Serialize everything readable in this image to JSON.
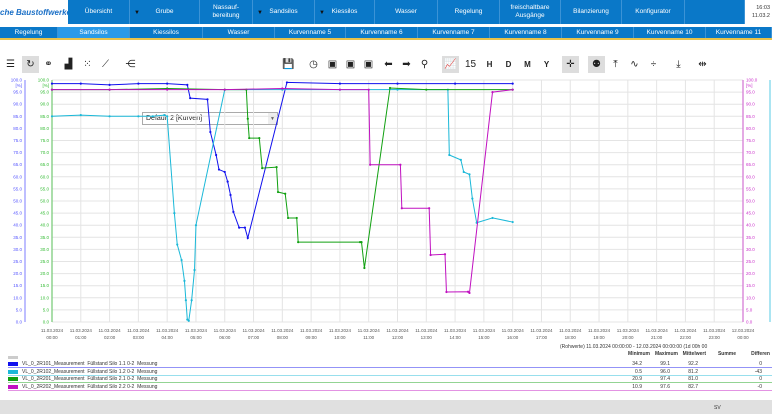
{
  "header": {
    "logo": "che Baustoffwerke",
    "time": "16:03",
    "date": "11.03.2",
    "nav": [
      {
        "label": "Übersicht",
        "chev": false
      },
      {
        "label": "Grube",
        "chev": true
      },
      {
        "label": "Nassauf-\nbereitung",
        "chev": false
      },
      {
        "label": "Sandsilos",
        "chev": true
      },
      {
        "label": "Kiessilos",
        "chev": true
      },
      {
        "label": "Wasser",
        "chev": false
      },
      {
        "label": "Regelung",
        "chev": false
      },
      {
        "label": "freischaltbare\nAusgänge",
        "chev": false
      },
      {
        "label": "Bilanzierung",
        "chev": false
      },
      {
        "label": "Konfigurator",
        "chev": false
      }
    ]
  },
  "subnav": {
    "active": 1,
    "items": [
      "Regelung",
      "Sandsilos",
      "Kiessilos",
      "Wasser",
      "Kurvenname 5",
      "Kurvenname 6",
      "Kurvenname 7",
      "Kurvenname 8",
      "Kurvenname 9",
      "Kurvenname 10",
      "Kurvenname 11"
    ]
  },
  "toolbar": {
    "preset": "Default 2 [Kurven]"
  },
  "chart_data": {
    "type": "line",
    "unit": "[%]",
    "ylim": [
      0,
      100
    ],
    "yticks": [
      0,
      5,
      10,
      15,
      20,
      25,
      30,
      35,
      40,
      45,
      50,
      55,
      60,
      65,
      70,
      75,
      80,
      85,
      90,
      95,
      100
    ],
    "xlim": [
      0,
      24
    ],
    "xdate": "11.03.2024",
    "xdate_end": "12.03.2024",
    "xticks": [
      "00:00",
      "01:00",
      "02:00",
      "03:00",
      "04:00",
      "05:00",
      "06:00",
      "07:00",
      "08:00",
      "09:00",
      "10:00",
      "11:00",
      "12:00",
      "13:00",
      "14:00",
      "15:00",
      "16:00",
      "17:00",
      "18:00",
      "19:00",
      "20:00",
      "21:00",
      "22:00",
      "23:00",
      "00:00"
    ],
    "series": [
      {
        "name": "VL_0_2R101_Measurement",
        "desc": "Füllstand Silo 1.1 0-2",
        "type": "Messung",
        "color": "#1010ee",
        "x": [
          0,
          1,
          2,
          3,
          4,
          4.7,
          4.8,
          5.4,
          5.5,
          5.7,
          5.8,
          6.0,
          6.1,
          6.2,
          6.3,
          6.5,
          6.7,
          6.8,
          8.16,
          10,
          12,
          14,
          16
        ],
        "y": [
          98.5,
          98.5,
          98,
          98.5,
          98.5,
          98,
          92.5,
          92,
          78.5,
          69,
          63,
          62,
          58,
          52.5,
          45.5,
          39,
          39,
          34.7,
          99,
          98.5,
          98.5,
          98.5,
          98.5
        ],
        "min": "34.2",
        "max": "99.1",
        "avg": "92.2",
        "sum": "",
        "diff": "0"
      },
      {
        "name": "VL_0_2R102_Measurement",
        "desc": "Füllstand Silo 1.2 0-2",
        "type": "Messung",
        "color": "#1ab8d8",
        "x": [
          0,
          1,
          2,
          3,
          3.5,
          3.9,
          4.0,
          4.25,
          4.35,
          4.5,
          4.6,
          4.65,
          4.7,
          4.75,
          4.85,
          4.95,
          5.0,
          6.0,
          8,
          10,
          12,
          13.75,
          13.8,
          14.2,
          14.3,
          14.5,
          14.6,
          14.75,
          15.3,
          16
        ],
        "y": [
          85,
          85.5,
          85,
          85,
          85,
          85.5,
          85,
          45,
          32,
          25.6,
          17,
          9,
          1,
          0.5,
          9,
          21.5,
          40,
          96,
          96,
          96,
          96,
          96,
          69,
          67,
          62,
          61,
          51,
          41,
          43,
          41.3
        ],
        "min": "0.5",
        "max": "96.0",
        "avg": "81.2",
        "sum": "",
        "diff": "-43"
      },
      {
        "name": "VL_0_2R201_Measurement",
        "desc": "Füllstand Silo 2.1 0-2",
        "type": "Messung",
        "color": "#10a010",
        "x": [
          0,
          2,
          4,
          6,
          6.75,
          6.8,
          6.85,
          7.2,
          7.3,
          7.8,
          7.85,
          8.1,
          8.2,
          8.5,
          8.55,
          10.7,
          10.75,
          10.85,
          11.74,
          13,
          16
        ],
        "y": [
          96,
          96,
          96.5,
          96,
          96,
          84,
          76,
          76,
          63.6,
          64,
          53.7,
          53,
          43,
          43,
          33,
          33,
          33,
          22.3,
          96.7,
          96,
          96
        ],
        "min": "20.9",
        "max": "97.4",
        "avg": "81.0",
        "sum": "",
        "diff": "0"
      },
      {
        "name": "VL_0_2R202_Measurement",
        "desc": "Füllstand Silo 2.2 0-2",
        "type": "Messung",
        "color": "#c010c0",
        "x": [
          0,
          2,
          4,
          6,
          8,
          10,
          11.0,
          11.05,
          12.1,
          12.15,
          13.1,
          13.15,
          13.65,
          13.7,
          14.45,
          14.5,
          15.3,
          16
        ],
        "y": [
          96,
          96,
          96,
          96,
          96.5,
          96,
          96,
          65,
          65,
          47,
          47,
          27.7,
          28,
          12.4,
          12.5,
          12,
          95,
          96
        ],
        "min": "10.9",
        "max": "97.6",
        "avg": "82.7",
        "sum": "",
        "diff": "-0"
      }
    ],
    "range_label": "(Rohwerte) 11.03.2024 00:00:00 - 12.03.2024 00:00:00 (1d 00h 00",
    "columns": [
      "Minimum",
      "Maximum",
      "Mittelwert",
      "Summe",
      "Differen"
    ]
  },
  "footer": {
    "label": "SV"
  }
}
